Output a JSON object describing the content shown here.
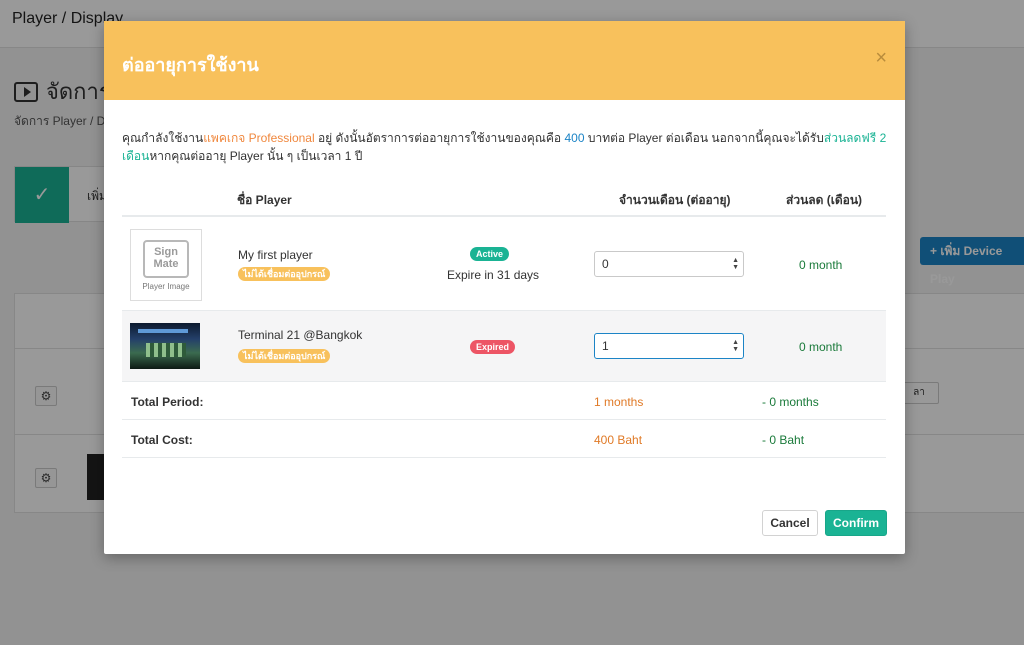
{
  "background": {
    "topbar_title": "Player / Display",
    "page_heading": "จัดการ",
    "breadcrumb": "จัดการ Player / D",
    "step_label": "เพิ่ม",
    "step_check": "✓",
    "add_device_button": "+ เพิ่ม Device Play",
    "gear_glyph": "⚙",
    "row_button": "ลา"
  },
  "modal": {
    "title": "ต่ออายุการใช้งาน",
    "close_glyph": "×",
    "intro": {
      "part1": "คุณกำลังใช้งาน",
      "package": "แพคเกจ Professional",
      "part2": " อยู่ ดังนั้นอัตราการต่ออายุการใช้งานของคุณคือ ",
      "price": "400",
      "part3": " บาทต่อ Player ต่อเดือน นอกจากนี้คุณจะได้รับ",
      "bonus": "ส่วนลดฟรี 2 เดือน",
      "part4": "หากคุณต่ออายุ Player นั้น ๆ เป็นเวลา 1 ปี"
    },
    "table": {
      "headers": {
        "player": "ชื่อ Player",
        "months": "จำนวนเดือน (ต่ออายุ)",
        "discount": "ส่วนลด (เดือน)"
      },
      "rows": [
        {
          "thumb_logo": "Sign Mate",
          "thumb_caption": "Player Image",
          "name": "My first player",
          "warn_badge": "ไม่ได้เชื่อมต่ออุปกรณ์",
          "status": "Active",
          "expire": "Expire in 31 days",
          "months_value": "0",
          "discount": "0 month"
        },
        {
          "name": "Terminal 21 @Bangkok",
          "warn_badge": "ไม่ได้เชื่อมต่ออุปกรณ์",
          "status": "Expired",
          "months_value": "1",
          "discount": "0 month"
        }
      ],
      "total_period": {
        "label": "Total Period:",
        "value": "1 months",
        "discount": "- 0 months"
      },
      "total_cost": {
        "label": "Total Cost:",
        "value": "400 Baht",
        "discount": "- 0 Baht"
      }
    },
    "buttons": {
      "cancel": "Cancel",
      "confirm": "Confirm"
    },
    "colors": {
      "header": "#f8c15c",
      "confirm": "#1ab394",
      "active": "#1ab394",
      "expired": "#ed5565"
    }
  }
}
